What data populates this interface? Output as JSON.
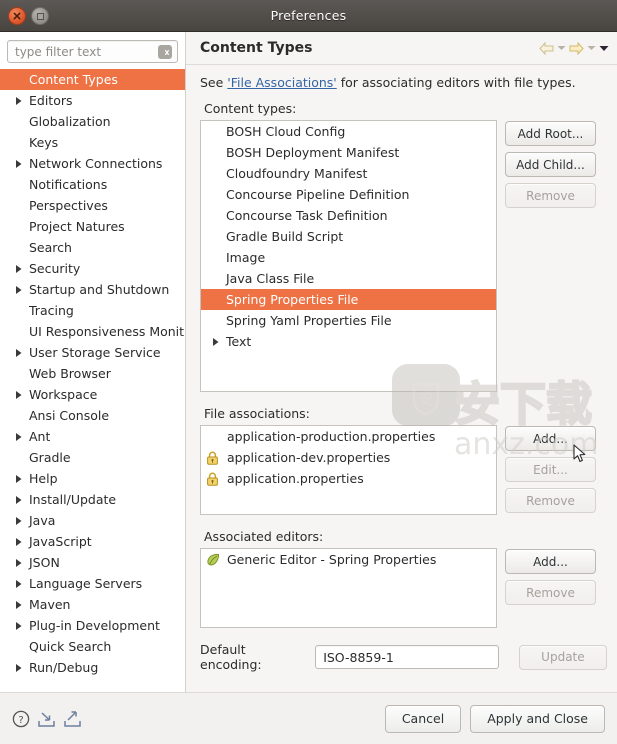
{
  "window": {
    "title": "Preferences",
    "close_label": "Close",
    "maximize_label": "Maximize"
  },
  "sidebar": {
    "filter": {
      "value": "",
      "placeholder": "type filter text",
      "clear_icon": "clear-icon"
    },
    "items": [
      {
        "label": "Content Types",
        "expandable": false,
        "selected": true,
        "indent": 1
      },
      {
        "label": "Editors",
        "expandable": true,
        "selected": false,
        "indent": 0
      },
      {
        "label": "Globalization",
        "expandable": false,
        "selected": false,
        "indent": 1
      },
      {
        "label": "Keys",
        "expandable": false,
        "selected": false,
        "indent": 1
      },
      {
        "label": "Network Connections",
        "expandable": true,
        "selected": false,
        "indent": 0
      },
      {
        "label": "Notifications",
        "expandable": false,
        "selected": false,
        "indent": 1
      },
      {
        "label": "Perspectives",
        "expandable": false,
        "selected": false,
        "indent": 1
      },
      {
        "label": "Project Natures",
        "expandable": false,
        "selected": false,
        "indent": 1
      },
      {
        "label": "Search",
        "expandable": false,
        "selected": false,
        "indent": 1
      },
      {
        "label": "Security",
        "expandable": true,
        "selected": false,
        "indent": 0
      },
      {
        "label": "Startup and Shutdown",
        "expandable": true,
        "selected": false,
        "indent": 0
      },
      {
        "label": "Tracing",
        "expandable": false,
        "selected": false,
        "indent": 1
      },
      {
        "label": "UI Responsiveness Monit",
        "expandable": false,
        "selected": false,
        "indent": 1
      },
      {
        "label": "User Storage Service",
        "expandable": true,
        "selected": false,
        "indent": 0
      },
      {
        "label": "Web Browser",
        "expandable": false,
        "selected": false,
        "indent": 1
      },
      {
        "label": "Workspace",
        "expandable": true,
        "selected": false,
        "indent": 0
      },
      {
        "label": "Ansi Console",
        "expandable": false,
        "selected": false,
        "indent": 1
      },
      {
        "label": "Ant",
        "expandable": true,
        "selected": false,
        "indent": 0
      },
      {
        "label": "Gradle",
        "expandable": false,
        "selected": false,
        "indent": 1
      },
      {
        "label": "Help",
        "expandable": true,
        "selected": false,
        "indent": 0
      },
      {
        "label": "Install/Update",
        "expandable": true,
        "selected": false,
        "indent": 0
      },
      {
        "label": "Java",
        "expandable": true,
        "selected": false,
        "indent": 0
      },
      {
        "label": "JavaScript",
        "expandable": true,
        "selected": false,
        "indent": 0
      },
      {
        "label": "JSON",
        "expandable": true,
        "selected": false,
        "indent": 0
      },
      {
        "label": "Language Servers",
        "expandable": true,
        "selected": false,
        "indent": 0
      },
      {
        "label": "Maven",
        "expandable": true,
        "selected": false,
        "indent": 0
      },
      {
        "label": "Plug-in Development",
        "expandable": true,
        "selected": false,
        "indent": 0
      },
      {
        "label": "Quick Search",
        "expandable": false,
        "selected": false,
        "indent": 1
      },
      {
        "label": "Run/Debug",
        "expandable": true,
        "selected": false,
        "indent": 0
      }
    ]
  },
  "page": {
    "title": "Content Types",
    "nav": {
      "back_icon": "arrow-left-icon",
      "back_menu_icon": "chevron-down-icon",
      "forward_icon": "arrow-right-icon",
      "forward_menu_icon": "chevron-down-icon",
      "view_menu_icon": "chevron-down-filled-icon"
    },
    "description": {
      "prefix": "See ",
      "link": "'File Associations'",
      "suffix": " for associating editors with file types."
    },
    "content_types": {
      "label": "Content types:",
      "items": [
        {
          "label": "BOSH Cloud Config",
          "expandable": false,
          "selected": false
        },
        {
          "label": "BOSH Deployment Manifest",
          "expandable": false,
          "selected": false
        },
        {
          "label": "Cloudfoundry Manifest",
          "expandable": false,
          "selected": false
        },
        {
          "label": "Concourse Pipeline Definition",
          "expandable": false,
          "selected": false
        },
        {
          "label": "Concourse Task Definition",
          "expandable": false,
          "selected": false
        },
        {
          "label": "Gradle Build Script",
          "expandable": false,
          "selected": false
        },
        {
          "label": "Image",
          "expandable": false,
          "selected": false
        },
        {
          "label": "Java Class File",
          "expandable": false,
          "selected": false
        },
        {
          "label": "Spring Properties File",
          "expandable": false,
          "selected": true
        },
        {
          "label": "Spring Yaml Properties File",
          "expandable": false,
          "selected": false
        },
        {
          "label": "Text",
          "expandable": true,
          "selected": false
        }
      ],
      "buttons": [
        {
          "label": "Add Root...",
          "enabled": true
        },
        {
          "label": "Add Child...",
          "enabled": true
        },
        {
          "label": "Remove",
          "enabled": false
        }
      ]
    },
    "file_associations": {
      "label": "File associations:",
      "items": [
        {
          "label": "application-production.properties",
          "locked": false
        },
        {
          "label": "application-dev.properties",
          "locked": true
        },
        {
          "label": "application.properties",
          "locked": true
        }
      ],
      "buttons": [
        {
          "label": "Add...",
          "enabled": true
        },
        {
          "label": "Edit...",
          "enabled": false
        },
        {
          "label": "Remove",
          "enabled": false
        }
      ]
    },
    "associated_editors": {
      "label": "Associated editors:",
      "items": [
        {
          "label": "Generic Editor - Spring Properties",
          "icon": "editor-leaf-icon"
        }
      ],
      "buttons": [
        {
          "label": "Add...",
          "enabled": true
        },
        {
          "label": "Remove",
          "enabled": false
        }
      ]
    },
    "default_encoding": {
      "label": "Default encoding:",
      "value": "ISO-8859-1",
      "update_button": {
        "label": "Update",
        "enabled": false
      }
    }
  },
  "footer": {
    "icons": [
      {
        "name": "help-icon"
      },
      {
        "name": "import-icon"
      },
      {
        "name": "export-icon"
      }
    ],
    "buttons": [
      {
        "label": "Cancel",
        "primary": false
      },
      {
        "label": "Apply and Close",
        "primary": false
      }
    ]
  },
  "watermark": {
    "text_cn": "安下载",
    "text_url": "anxz.com"
  },
  "colors": {
    "selection": "#ef7245",
    "link": "#3465a4",
    "titlebar": "#4f4b47",
    "close_button": "#d9522a"
  }
}
